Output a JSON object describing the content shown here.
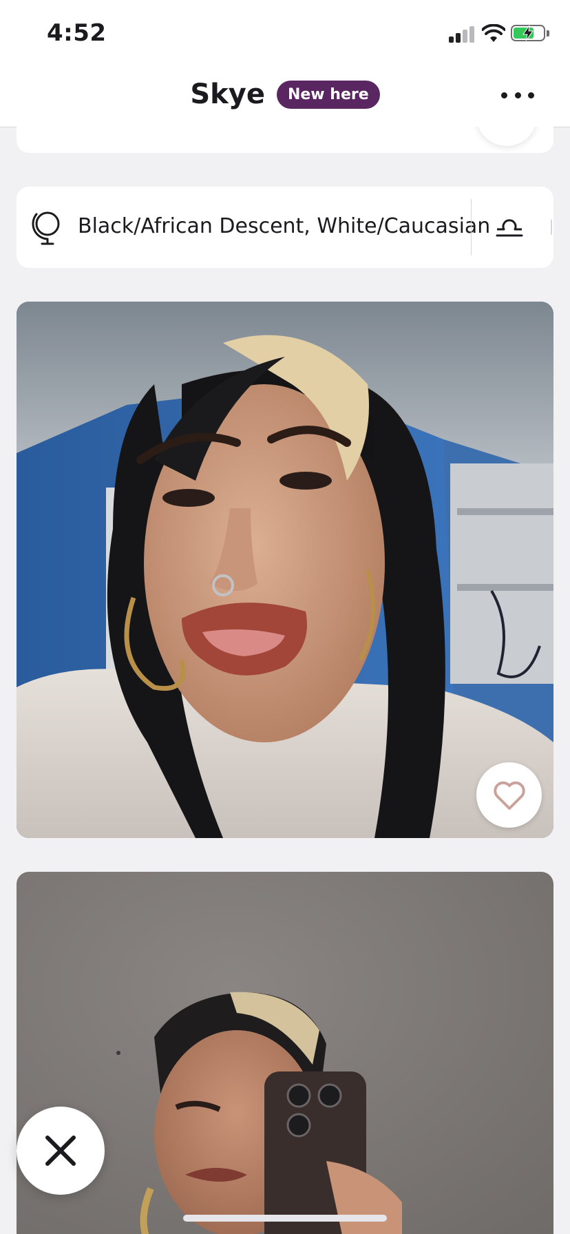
{
  "status_bar": {
    "time": "4:52",
    "signal_icon": "cellular-signal-icon",
    "wifi_icon": "wifi-icon",
    "battery_icon": "battery-charging-icon",
    "battery_level": 0.62
  },
  "header": {
    "name": "Skye",
    "badge": "New here",
    "more_icon": "more-horizontal-icon"
  },
  "profile": {
    "ethnicity": "Black/African Descent, White/Caucasian",
    "ethnicity_icon": "globe-icon",
    "zodiac_icon": "libra-icon"
  },
  "photos": [
    {
      "like_icon": "heart-outline-icon"
    },
    {}
  ],
  "actions": {
    "pass_icon": "close-x-icon"
  },
  "colors": {
    "badge_bg": "#5a2662",
    "page_bg": "#f1f1f3",
    "heart_outline": "#c9a39b",
    "battery_green": "#34c759"
  }
}
